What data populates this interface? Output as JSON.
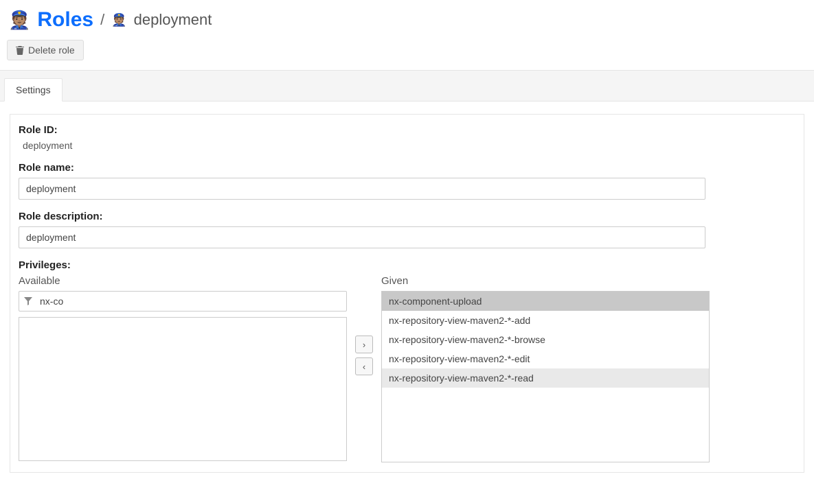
{
  "breadcrumb": {
    "roles_label": "Roles",
    "current": "deployment"
  },
  "toolbar": {
    "delete_label": "Delete role"
  },
  "tabs": {
    "settings": "Settings"
  },
  "fields": {
    "role_id_label": "Role ID:",
    "role_id_value": "deployment",
    "role_name_label": "Role name:",
    "role_name_value": "deployment",
    "role_desc_label": "Role description:",
    "role_desc_value": "deployment",
    "privileges_label": "Privileges:"
  },
  "privileges": {
    "available_label": "Available",
    "given_label": "Given",
    "filter_value": "nx-co",
    "available_items": [],
    "given_items": [
      {
        "label": "nx-component-upload",
        "state": "sel"
      },
      {
        "label": "nx-repository-view-maven2-*-add",
        "state": ""
      },
      {
        "label": "nx-repository-view-maven2-*-browse",
        "state": ""
      },
      {
        "label": "nx-repository-view-maven2-*-edit",
        "state": ""
      },
      {
        "label": "nx-repository-view-maven2-*-read",
        "state": "selweak"
      }
    ]
  },
  "arrows": {
    "right": "›",
    "left": "‹"
  }
}
